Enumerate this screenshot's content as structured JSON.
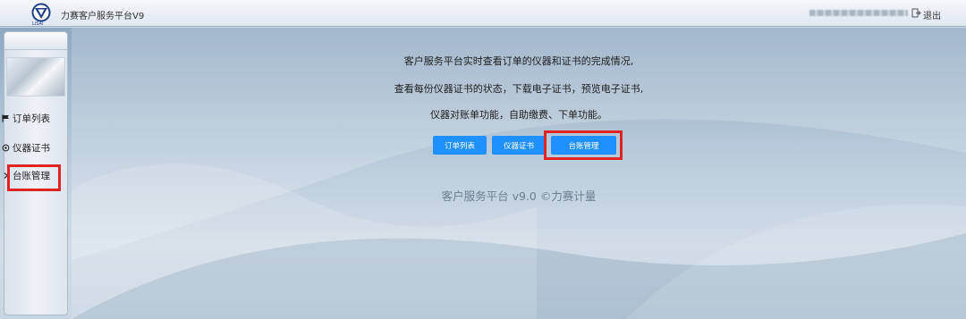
{
  "header": {
    "logo_text": "LISAI",
    "app_title": "力赛客户服务平台V9",
    "logout_label": "退出"
  },
  "sidebar": {
    "items": [
      {
        "label": "订单列表",
        "icon": "flag-icon"
      },
      {
        "label": "仪器证书",
        "icon": "gear-icon"
      },
      {
        "label": "台账管理",
        "icon": "chevron-right-icon"
      }
    ]
  },
  "main": {
    "description": [
      "客户服务平台实时查看订单的仪器和证书的完成情况,",
      "查看每份仪器证书的状态，下载电子证书，预览电子证书,",
      "仪器对账单功能，自助缴费、下单功能。"
    ],
    "buttons": [
      {
        "label": "订单列表"
      },
      {
        "label": "仪器证书"
      },
      {
        "label": "台账管理"
      }
    ],
    "footer": "客户服务平台 v9.0 ©力赛计量"
  },
  "colors": {
    "button": "#1e90ff",
    "highlight": "#e02424"
  }
}
